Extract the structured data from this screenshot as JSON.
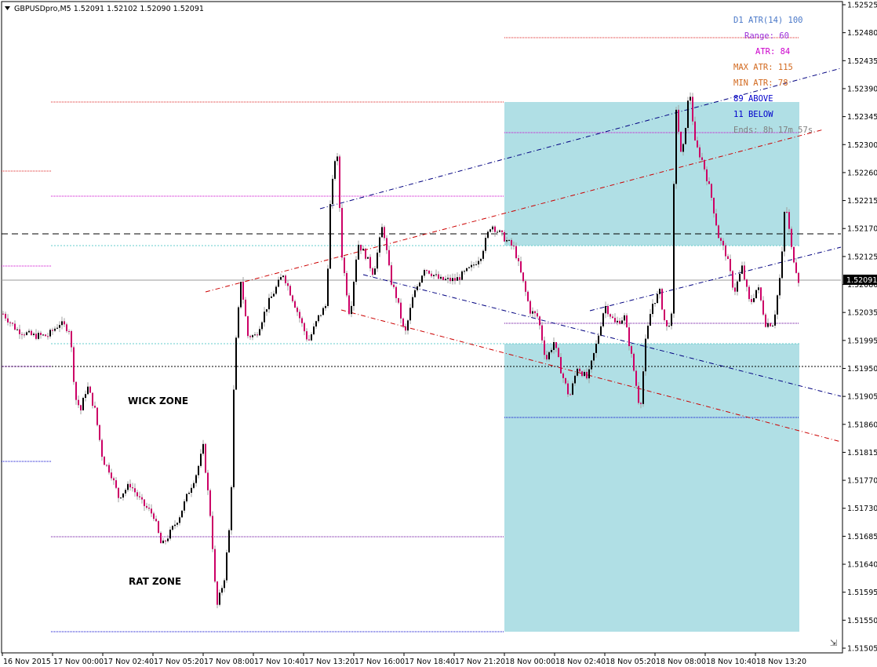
{
  "header": {
    "title": "GBPUSDpro,M5  1.52091 1.52102 1.52090 1.52091"
  },
  "colors": {
    "background": "#ffffff",
    "zone": "#b0dfe5",
    "candle_bear": "#cc0066",
    "candle_bull": "#000000",
    "wick": "#a0a0a0",
    "trend_blue": "#000080",
    "trend_red": "#cc0000",
    "level_red": "#dd2222",
    "level_magenta": "#cc00cc",
    "level_blue": "#0000cc",
    "level_purple": "#660099",
    "level_cyan": "#66cccc",
    "price_label_bg": "#000000",
    "price_label_fg": "#ffffff"
  },
  "chart_data": {
    "type": "candlestick",
    "symbol": "GBPUSDpro",
    "timeframe": "M5",
    "ohlc": {
      "bid": 1.52091,
      "high": 1.52102,
      "low": 1.5209,
      "close": 1.52091
    },
    "ylim": [
      1.51496,
      1.52534
    ],
    "y_ticks": [
      "1.52525",
      "1.52480",
      "1.52435",
      "1.52390",
      "1.52345",
      "1.52300",
      "1.52260",
      "1.52215",
      "1.52170",
      "1.52125",
      "1.52080",
      "1.52035",
      "1.51995",
      "1.51950",
      "1.51905",
      "1.51860",
      "1.51815",
      "1.51770",
      "1.51730",
      "1.51685",
      "1.51640",
      "1.51595",
      "1.51550",
      "1.51505"
    ],
    "x_ticks": [
      "16 Nov 2015",
      "17 Nov 00:00",
      "17 Nov 02:40",
      "17 Nov 05:20",
      "17 Nov 08:00",
      "17 Nov 10:40",
      "17 Nov 13:20",
      "17 Nov 16:00",
      "17 Nov 18:40",
      "17 Nov 21:20",
      "18 Nov 00:00",
      "18 Nov 02:40",
      "18 Nov 05:20",
      "18 Nov 08:00",
      "18 Nov 10:40",
      "18 Nov 13:20"
    ],
    "current_price_label": "1.52091",
    "price_path": [
      [
        0,
        1.5204
      ],
      [
        20,
        1.5201
      ],
      [
        40,
        1.52
      ],
      [
        60,
        1.52
      ],
      [
        75,
        1.5202
      ],
      [
        88,
        1.5201
      ],
      [
        95,
        1.519
      ],
      [
        102,
        1.5188
      ],
      [
        110,
        1.5192
      ],
      [
        120,
        1.5188
      ],
      [
        130,
        1.518
      ],
      [
        140,
        1.5178
      ],
      [
        150,
        1.5174
      ],
      [
        165,
        1.5176
      ],
      [
        180,
        1.5173
      ],
      [
        195,
        1.5171
      ],
      [
        205,
        1.5166
      ],
      [
        215,
        1.5168
      ],
      [
        228,
        1.5171
      ],
      [
        240,
        1.5175
      ],
      [
        250,
        1.5178
      ],
      [
        258,
        1.5182
      ],
      [
        268,
        1.517
      ],
      [
        275,
        1.5156
      ],
      [
        285,
        1.5161
      ],
      [
        293,
        1.5171
      ],
      [
        298,
        1.5196
      ],
      [
        306,
        1.5209
      ],
      [
        315,
        1.52
      ],
      [
        325,
        1.52
      ],
      [
        340,
        1.5205
      ],
      [
        360,
        1.521
      ],
      [
        375,
        1.5205
      ],
      [
        392,
        1.5199
      ],
      [
        405,
        1.5203
      ],
      [
        415,
        1.5205
      ],
      [
        420,
        1.5221
      ],
      [
        428,
        1.5231
      ],
      [
        435,
        1.5213
      ],
      [
        445,
        1.5203
      ],
      [
        455,
        1.5215
      ],
      [
        465,
        1.5213
      ],
      [
        475,
        1.521
      ],
      [
        487,
        1.5218
      ],
      [
        497,
        1.5209
      ],
      [
        505,
        1.5206
      ],
      [
        515,
        1.52
      ],
      [
        525,
        1.5206
      ],
      [
        540,
        1.5211
      ],
      [
        560,
        1.5209
      ],
      [
        580,
        1.5209
      ],
      [
        600,
        1.5211
      ],
      [
        612,
        1.5213
      ],
      [
        625,
        1.5218
      ],
      [
        640,
        1.5216
      ],
      [
        655,
        1.5214
      ],
      [
        665,
        1.5209
      ],
      [
        675,
        1.5204
      ],
      [
        685,
        1.5203
      ],
      [
        695,
        1.5196
      ],
      [
        705,
        1.5199
      ],
      [
        715,
        1.5194
      ],
      [
        725,
        1.519
      ],
      [
        735,
        1.5195
      ],
      [
        748,
        1.5193
      ],
      [
        760,
        1.5199
      ],
      [
        770,
        1.5205
      ],
      [
        783,
        1.5202
      ],
      [
        795,
        1.5203
      ],
      [
        805,
        1.5196
      ],
      [
        815,
        1.5188
      ],
      [
        822,
        1.5199
      ],
      [
        830,
        1.5205
      ],
      [
        840,
        1.5207
      ],
      [
        848,
        1.5201
      ],
      [
        855,
        1.5203
      ],
      [
        860,
        1.5238
      ],
      [
        868,
        1.5228
      ],
      [
        878,
        1.524
      ],
      [
        885,
        1.5231
      ],
      [
        895,
        1.5228
      ],
      [
        905,
        1.5223
      ],
      [
        915,
        1.5216
      ],
      [
        925,
        1.5213
      ],
      [
        935,
        1.5207
      ],
      [
        945,
        1.5211
      ],
      [
        955,
        1.5205
      ],
      [
        965,
        1.5208
      ],
      [
        975,
        1.5202
      ],
      [
        985,
        1.5202
      ],
      [
        995,
        1.5211
      ],
      [
        1000,
        1.5222
      ],
      [
        1008,
        1.5214
      ],
      [
        1017,
        1.5209
      ]
    ]
  },
  "annotations": {
    "wick_zone": "WICK ZONE",
    "rat_zone": "RAT ZONE"
  },
  "indicator": {
    "d1_atr": "D1 ATR(14) 100",
    "range": "Range: 60",
    "atr": "ATR: 84",
    "max_atr": "MAX ATR: 115",
    "min_atr": "MIN ATR: 78",
    "above": "89 ABOVE",
    "below": "11 BELOW",
    "ends": "Ends: 8h 17m 57s"
  },
  "icons": {
    "dropdown": "triangle-down-icon",
    "autoscroll": "autoscroll-icon"
  }
}
